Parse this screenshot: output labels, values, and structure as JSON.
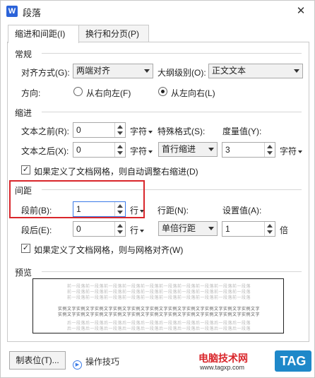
{
  "window": {
    "app_icon": "W",
    "title": "段落",
    "close_glyph": "✕"
  },
  "tabs": [
    {
      "label": "缩进和间距(I)",
      "active": true
    },
    {
      "label": "换行和分页(P)",
      "active": false
    }
  ],
  "general": {
    "section_title": "常规",
    "alignment_label": "对齐方式(G):",
    "alignment_value": "两端对齐",
    "outline_label": "大纲级别(O):",
    "outline_value": "正文文本",
    "direction_label": "方向:",
    "rtl_label": "从右向左(F)",
    "ltr_label": "从左向右(L)",
    "direction_selected": "ltr"
  },
  "indent": {
    "section_title": "缩进",
    "before_label": "文本之前(R):",
    "before_value": "0",
    "before_unit": "字符",
    "after_label": "文本之后(X):",
    "after_value": "0",
    "after_unit": "字符",
    "special_label": "特殊格式(S):",
    "special_value": "首行缩进",
    "measure_label": "度量值(Y):",
    "measure_value": "3",
    "measure_unit": "字符",
    "grid_checkbox_label": "如果定义了文档网格，则自动调整右缩进(D)",
    "grid_checkbox_checked": true
  },
  "spacing": {
    "section_title": "间距",
    "before_label": "段前(B):",
    "before_value": "1",
    "before_unit": "行",
    "after_label": "段后(E):",
    "after_value": "0",
    "after_unit": "行",
    "line_spacing_label": "行距(N):",
    "line_spacing_value": "单倍行距",
    "setting_label": "设置值(A):",
    "setting_value": "1",
    "setting_unit": "倍",
    "grid_checkbox_label": "如果定义了文档网格，则与网格对齐(W)",
    "grid_checkbox_checked": true
  },
  "preview": {
    "section_title": "预览",
    "prev_para_line": "前一段落前一段落前一段落前一段落前一段落前一段落前一段落前一段落前一段落前一段落",
    "sample_line": "实例文字实例文字实例文字实例文字实例文字实例文字实例文字实例文字实例文字实例文字实例文字",
    "next_para_line": "后一段落后一段落后一段落后一段落后一段落后一段落后一段落后一段落后一段落后一段落"
  },
  "footer": {
    "tabs_button": "制表位(T)...",
    "tips_link": "操作技巧",
    "tips_icon_glyph": "▶"
  },
  "watermark": {
    "site_name": "电脑技术网",
    "url": "www.tagxp.com",
    "tag": "TAG"
  },
  "colors": {
    "highlight": "#d9262b",
    "app_icon": "#2b63d9",
    "watermark_tag": "#1e88c9"
  }
}
